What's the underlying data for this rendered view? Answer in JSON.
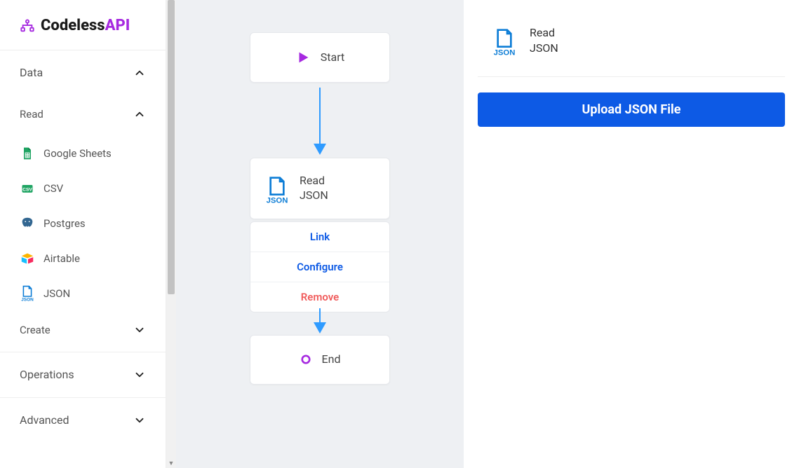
{
  "logo": {
    "text_a": "Codeless",
    "text_b": "API"
  },
  "sidebar": {
    "sections": {
      "data": {
        "label": "Data",
        "expanded": true
      },
      "read": {
        "label": "Read",
        "expanded": true
      },
      "create": {
        "label": "Create",
        "expanded": false
      },
      "operations": {
        "label": "Operations",
        "expanded": false
      },
      "advanced": {
        "label": "Advanced",
        "expanded": false
      }
    },
    "items": [
      {
        "label": "Google Sheets",
        "icon": "google-sheets-icon"
      },
      {
        "label": "CSV",
        "icon": "csv-icon"
      },
      {
        "label": "Postgres",
        "icon": "postgres-icon"
      },
      {
        "label": "Airtable",
        "icon": "airtable-icon"
      },
      {
        "label": "JSON",
        "icon": "json-icon"
      }
    ]
  },
  "canvas": {
    "start": {
      "label": "Start"
    },
    "json_node": {
      "line1": "Read",
      "line2": "JSON"
    },
    "menu": {
      "link": "Link",
      "configure": "Configure",
      "remove": "Remove"
    },
    "end": {
      "label": "End"
    }
  },
  "panel": {
    "header": {
      "line1": "Read",
      "line2": "JSON"
    },
    "upload_label": "Upload JSON File"
  },
  "colors": {
    "accent_purple": "#a629e0",
    "accent_blue": "#0d5ae5",
    "arrow_blue": "#2f9bff",
    "danger": "#f05b5b",
    "json_blue": "#0d7dd6"
  }
}
